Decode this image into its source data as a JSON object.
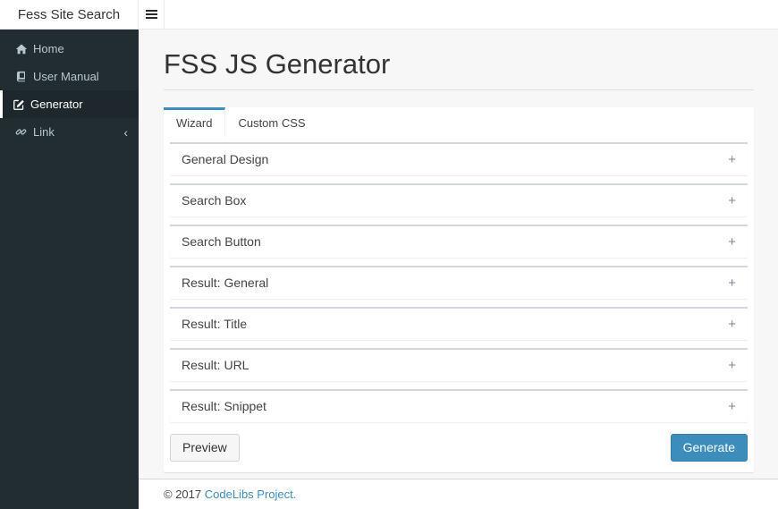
{
  "navbar": {
    "brand": "Fess Site Search"
  },
  "sidebar": {
    "items": [
      {
        "label": "Home",
        "icon": "home-icon",
        "active": false
      },
      {
        "label": "User Manual",
        "icon": "book-icon",
        "active": false
      },
      {
        "label": "Generator",
        "icon": "pencil-square-icon",
        "active": true
      },
      {
        "label": "Link",
        "icon": "link-icon",
        "active": false,
        "chevron": "‹"
      }
    ]
  },
  "page": {
    "title": "FSS JS Generator"
  },
  "tabs": [
    {
      "label": "Wizard",
      "active": true
    },
    {
      "label": "Custom CSS",
      "active": false
    }
  ],
  "accordion": {
    "sections": [
      {
        "label": "General Design",
        "toggle": "+"
      },
      {
        "label": "Search Box",
        "toggle": "+"
      },
      {
        "label": "Search Button",
        "toggle": "+"
      },
      {
        "label": "Result: General",
        "toggle": "+"
      },
      {
        "label": "Result: Title",
        "toggle": "+"
      },
      {
        "label": "Result: URL",
        "toggle": "+"
      },
      {
        "label": "Result: Snippet",
        "toggle": "+"
      }
    ]
  },
  "actions": {
    "preview_label": "Preview",
    "generate_label": "Generate"
  },
  "footer": {
    "copyright": "© 2017",
    "link_label": "CodeLibs Project."
  },
  "colors": {
    "accent": "#3c8dbc",
    "accent_border": "#367fa9",
    "sidebar_bg": "#222d32",
    "sidebar_active_bg": "#1e282c",
    "sidebar_text": "#b8c7ce",
    "box_top_border": "#d2d6de",
    "content_bg": "#f7f7f7"
  }
}
